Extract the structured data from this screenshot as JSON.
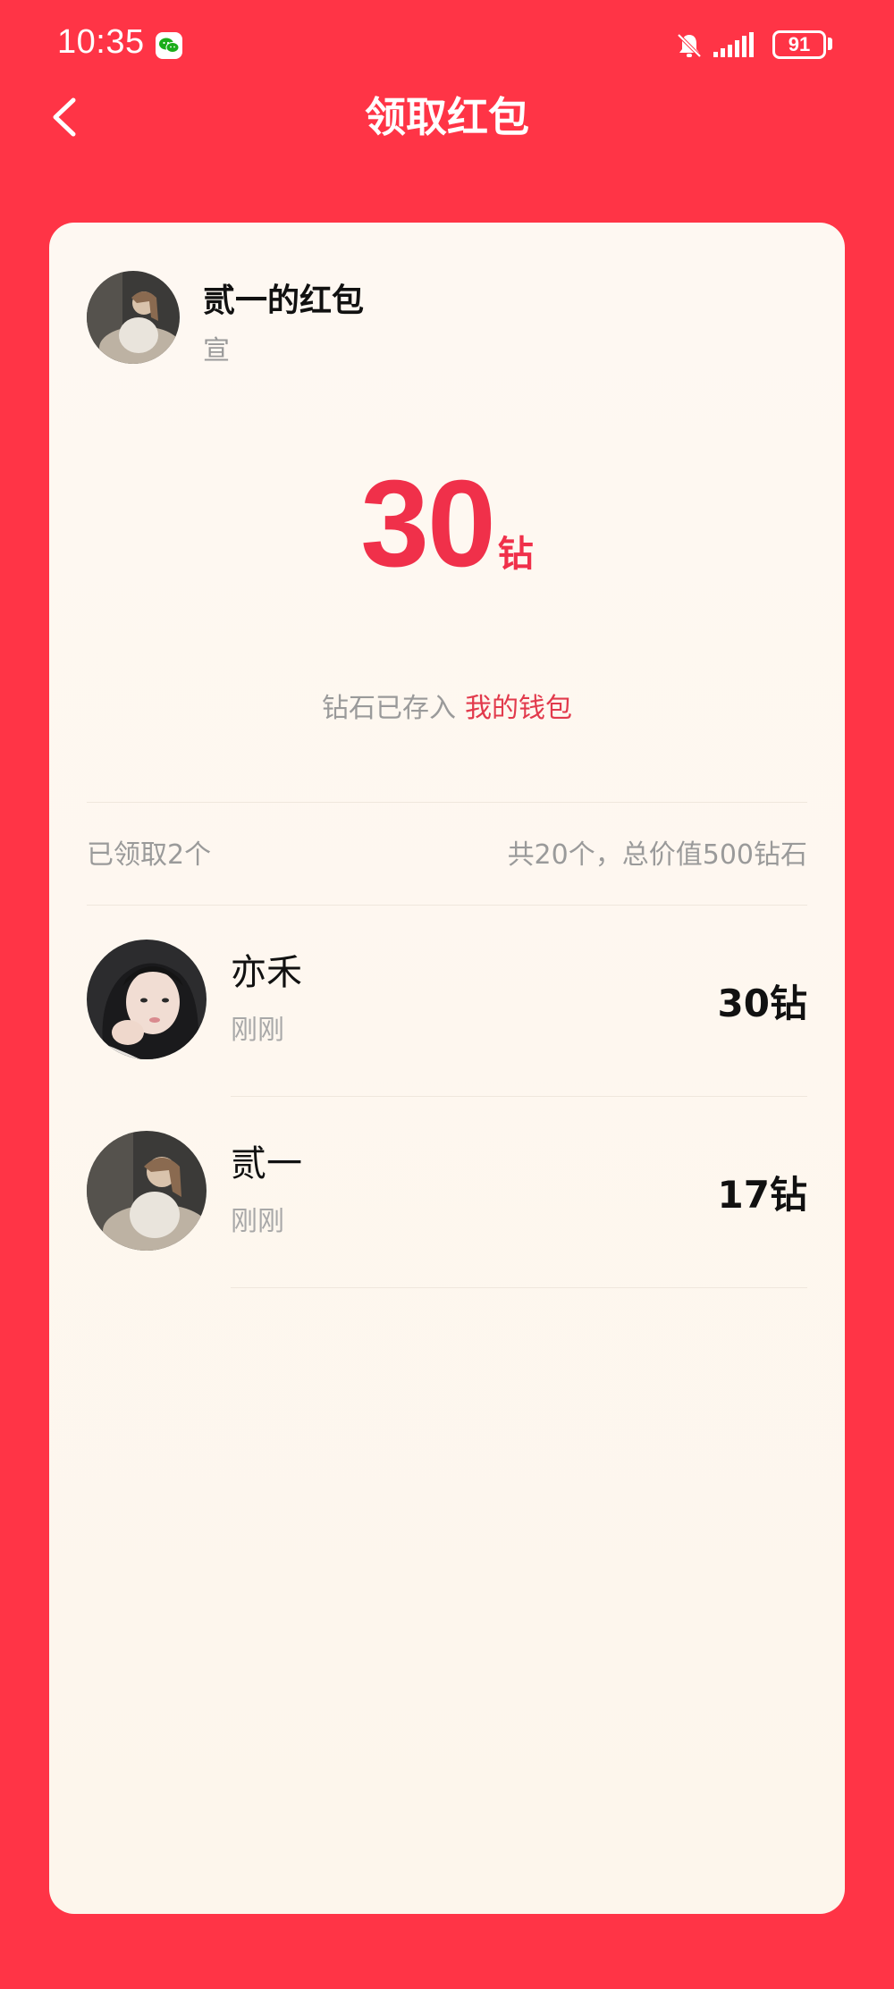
{
  "status_bar": {
    "time": "10:35",
    "battery": "91"
  },
  "header": {
    "title": "领取红包"
  },
  "envelope": {
    "sender_title": "贰一的红包",
    "sender_sub": "宣",
    "amount": "30",
    "amount_unit": "钻",
    "wallet_prefix": "钻石已存入",
    "wallet_link": "我的钱包"
  },
  "summary": {
    "received": "已领取2个",
    "total": "共20个，总价值500钻石"
  },
  "records": [
    {
      "name": "亦禾",
      "time": "刚刚",
      "amount": "30钻"
    },
    {
      "name": "贰一",
      "time": "刚刚",
      "amount": "17钻"
    }
  ],
  "colors": {
    "background": "#FF3446",
    "accent": "#F0304A",
    "card": "#FEF8F2"
  },
  "icons": {
    "back": "chevron-left-icon",
    "notification": "bell-off-icon",
    "signal": "signal-icon",
    "battery": "battery-icon",
    "wechat": "wechat-icon"
  }
}
